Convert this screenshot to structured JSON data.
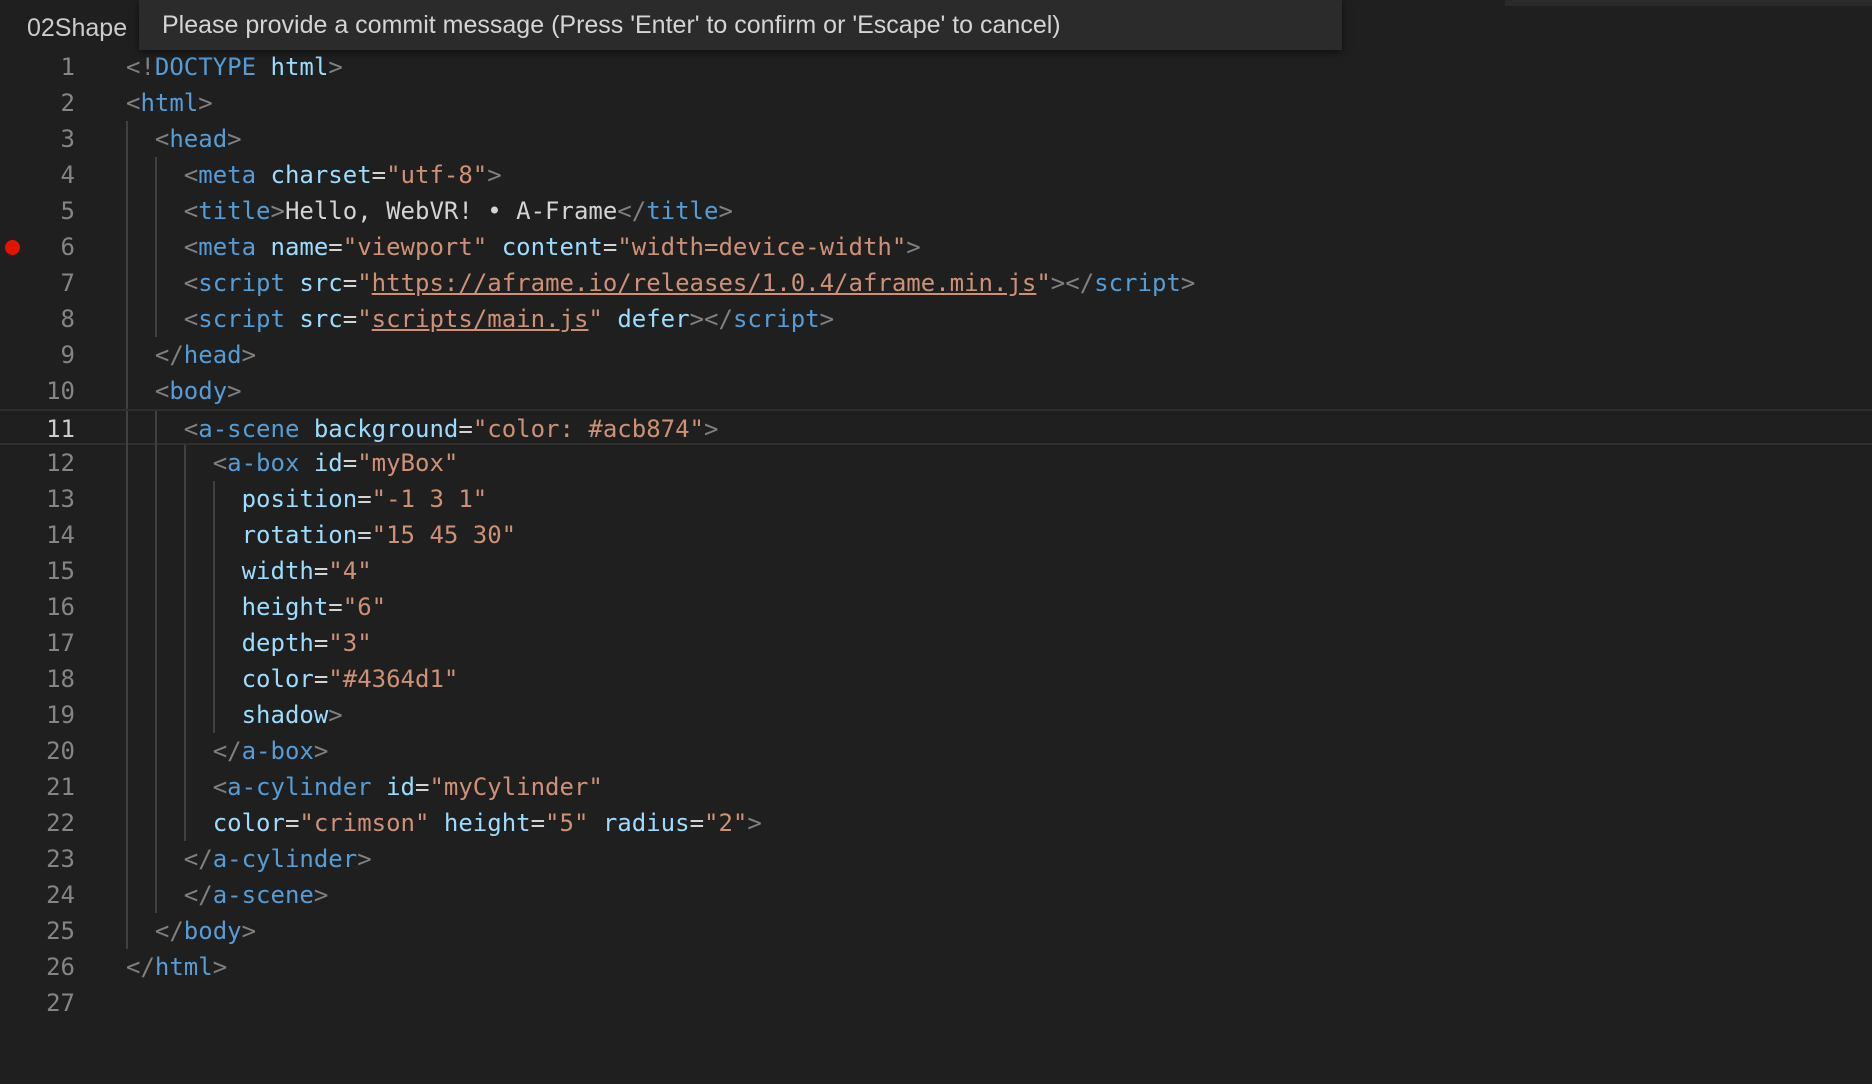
{
  "breadcrumb": "02Shape",
  "commit_prompt": "Please provide a commit message (Press 'Enter' to confirm or 'Escape' to cancel)",
  "current_line": 11,
  "breakpoint_line": 6,
  "colors": {
    "background": "#1f1f1f",
    "tag": "#569cd6",
    "bracket": "#808080",
    "attribute": "#9cdcfe",
    "string": "#ce9178",
    "text": "#d4d4d4",
    "breakpoint": "#e51400"
  },
  "lines": [
    {
      "n": "1",
      "indent": 0,
      "tokens": [
        [
          "br",
          "<!"
        ],
        [
          "tag",
          "DOCTYPE"
        ],
        [
          "text",
          " "
        ],
        [
          "attr",
          "html"
        ],
        [
          "br",
          ">"
        ]
      ]
    },
    {
      "n": "2",
      "indent": 0,
      "tokens": [
        [
          "br",
          "<"
        ],
        [
          "tag",
          "html"
        ],
        [
          "br",
          ">"
        ]
      ]
    },
    {
      "n": "3",
      "indent": 1,
      "tokens": [
        [
          "br",
          "<"
        ],
        [
          "tag",
          "head"
        ],
        [
          "br",
          ">"
        ]
      ]
    },
    {
      "n": "4",
      "indent": 2,
      "tokens": [
        [
          "br",
          "<"
        ],
        [
          "tag",
          "meta"
        ],
        [
          "text",
          " "
        ],
        [
          "attr",
          "charset"
        ],
        [
          "text",
          "="
        ],
        [
          "str",
          "\"utf-8\""
        ],
        [
          "br",
          ">"
        ]
      ]
    },
    {
      "n": "5",
      "indent": 2,
      "tokens": [
        [
          "br",
          "<"
        ],
        [
          "tag",
          "title"
        ],
        [
          "br",
          ">"
        ],
        [
          "text",
          "Hello, WebVR! • A-Frame"
        ],
        [
          "br",
          "</"
        ],
        [
          "tag",
          "title"
        ],
        [
          "br",
          ">"
        ]
      ]
    },
    {
      "n": "6",
      "indent": 2,
      "tokens": [
        [
          "br",
          "<"
        ],
        [
          "tag",
          "meta"
        ],
        [
          "text",
          " "
        ],
        [
          "attr",
          "name"
        ],
        [
          "text",
          "="
        ],
        [
          "str",
          "\"viewport\""
        ],
        [
          "text",
          " "
        ],
        [
          "attr",
          "content"
        ],
        [
          "text",
          "="
        ],
        [
          "str",
          "\"width=device-width\""
        ],
        [
          "br",
          ">"
        ]
      ]
    },
    {
      "n": "7",
      "indent": 2,
      "tokens": [
        [
          "br",
          "<"
        ],
        [
          "tag",
          "script"
        ],
        [
          "text",
          " "
        ],
        [
          "attr",
          "src"
        ],
        [
          "text",
          "="
        ],
        [
          "str",
          "\""
        ],
        [
          "link",
          "https://aframe.io/releases/1.0.4/aframe.min.js"
        ],
        [
          "str",
          "\""
        ],
        [
          "br",
          "></"
        ],
        [
          "tag",
          "script"
        ],
        [
          "br",
          ">"
        ]
      ]
    },
    {
      "n": "8",
      "indent": 2,
      "tokens": [
        [
          "br",
          "<"
        ],
        [
          "tag",
          "script"
        ],
        [
          "text",
          " "
        ],
        [
          "attr",
          "src"
        ],
        [
          "text",
          "="
        ],
        [
          "str",
          "\""
        ],
        [
          "link",
          "scripts/main.js"
        ],
        [
          "str",
          "\""
        ],
        [
          "text",
          " "
        ],
        [
          "attr",
          "defer"
        ],
        [
          "br",
          "></"
        ],
        [
          "tag",
          "script"
        ],
        [
          "br",
          ">"
        ]
      ]
    },
    {
      "n": "9",
      "indent": 1,
      "tokens": [
        [
          "br",
          "</"
        ],
        [
          "tag",
          "head"
        ],
        [
          "br",
          ">"
        ]
      ]
    },
    {
      "n": "10",
      "indent": 1,
      "tokens": [
        [
          "br",
          "<"
        ],
        [
          "tag",
          "body"
        ],
        [
          "br",
          ">"
        ]
      ]
    },
    {
      "n": "11",
      "indent": 2,
      "tokens": [
        [
          "br",
          "<"
        ],
        [
          "tag",
          "a-scene"
        ],
        [
          "text",
          " "
        ],
        [
          "attr",
          "background"
        ],
        [
          "text",
          "="
        ],
        [
          "str",
          "\"color: #acb874\""
        ],
        [
          "br",
          ">"
        ]
      ]
    },
    {
      "n": "12",
      "indent": 3,
      "tokens": [
        [
          "br",
          "<"
        ],
        [
          "tag",
          "a-box"
        ],
        [
          "text",
          " "
        ],
        [
          "attr",
          "id"
        ],
        [
          "text",
          "="
        ],
        [
          "str",
          "\"myBox\""
        ]
      ]
    },
    {
      "n": "13",
      "indent": 4,
      "tokens": [
        [
          "attr",
          "position"
        ],
        [
          "text",
          "="
        ],
        [
          "str",
          "\"-1 3 1\""
        ]
      ]
    },
    {
      "n": "14",
      "indent": 4,
      "tokens": [
        [
          "attr",
          "rotation"
        ],
        [
          "text",
          "="
        ],
        [
          "str",
          "\"15 45 30\""
        ]
      ]
    },
    {
      "n": "15",
      "indent": 4,
      "tokens": [
        [
          "attr",
          "width"
        ],
        [
          "text",
          "="
        ],
        [
          "str",
          "\"4\""
        ]
      ]
    },
    {
      "n": "16",
      "indent": 4,
      "tokens": [
        [
          "attr",
          "height"
        ],
        [
          "text",
          "="
        ],
        [
          "str",
          "\"6\""
        ]
      ]
    },
    {
      "n": "17",
      "indent": 4,
      "tokens": [
        [
          "attr",
          "depth"
        ],
        [
          "text",
          "="
        ],
        [
          "str",
          "\"3\""
        ]
      ]
    },
    {
      "n": "18",
      "indent": 4,
      "tokens": [
        [
          "attr",
          "color"
        ],
        [
          "text",
          "="
        ],
        [
          "str",
          "\"#4364d1\""
        ]
      ]
    },
    {
      "n": "19",
      "indent": 4,
      "tokens": [
        [
          "attr",
          "shadow"
        ],
        [
          "br",
          ">"
        ]
      ]
    },
    {
      "n": "20",
      "indent": 3,
      "tokens": [
        [
          "br",
          "</"
        ],
        [
          "tag",
          "a-box"
        ],
        [
          "br",
          ">"
        ]
      ]
    },
    {
      "n": "21",
      "indent": 3,
      "tokens": [
        [
          "br",
          "<"
        ],
        [
          "tag",
          "a-cylinder"
        ],
        [
          "text",
          " "
        ],
        [
          "attr",
          "id"
        ],
        [
          "text",
          "="
        ],
        [
          "str",
          "\"myCylinder\""
        ]
      ]
    },
    {
      "n": "22",
      "indent": 3,
      "tokens": [
        [
          "attr",
          "color"
        ],
        [
          "text",
          "="
        ],
        [
          "str",
          "\"crimson\""
        ],
        [
          "text",
          " "
        ],
        [
          "attr",
          "height"
        ],
        [
          "text",
          "="
        ],
        [
          "str",
          "\"5\""
        ],
        [
          "text",
          " "
        ],
        [
          "attr",
          "radius"
        ],
        [
          "text",
          "="
        ],
        [
          "str",
          "\"2\""
        ],
        [
          "br",
          ">"
        ]
      ]
    },
    {
      "n": "23",
      "indent": 2,
      "tokens": [
        [
          "br",
          "</"
        ],
        [
          "tag",
          "a-cylinder"
        ],
        [
          "br",
          ">"
        ]
      ]
    },
    {
      "n": "24",
      "indent": 2,
      "tokens": [
        [
          "br",
          "</"
        ],
        [
          "tag",
          "a-scene"
        ],
        [
          "br",
          ">"
        ]
      ]
    },
    {
      "n": "25",
      "indent": 1,
      "tokens": [
        [
          "br",
          "</"
        ],
        [
          "tag",
          "body"
        ],
        [
          "br",
          ">"
        ]
      ]
    },
    {
      "n": "26",
      "indent": 0,
      "tokens": [
        [
          "br",
          "</"
        ],
        [
          "tag",
          "html"
        ],
        [
          "br",
          ">"
        ]
      ]
    },
    {
      "n": "27",
      "indent": 0,
      "tokens": []
    }
  ]
}
